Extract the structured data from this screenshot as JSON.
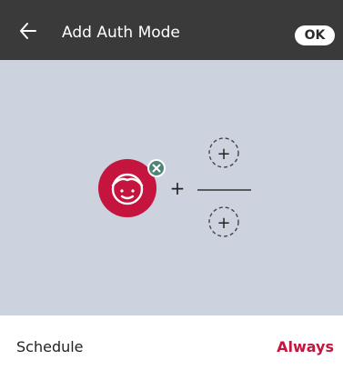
{
  "header": {
    "back_icon": "arrow-left-icon",
    "title": "Add Auth Mode",
    "ok_label": "OK"
  },
  "auth_diagram": {
    "primary_method_icon": "face-icon",
    "remove_icon": "close-circle-icon",
    "operator_plus": "+",
    "slots": [
      {
        "icon": "add-circle-icon",
        "label": "+"
      },
      {
        "icon": "add-circle-icon",
        "label": "+"
      }
    ]
  },
  "schedule": {
    "label": "Schedule",
    "value": "Always"
  },
  "colors": {
    "header_bg": "#3a3a3a",
    "canvas_bg": "#cdd3de",
    "accent": "#c5153f",
    "remove_badge": "#4f8577"
  }
}
